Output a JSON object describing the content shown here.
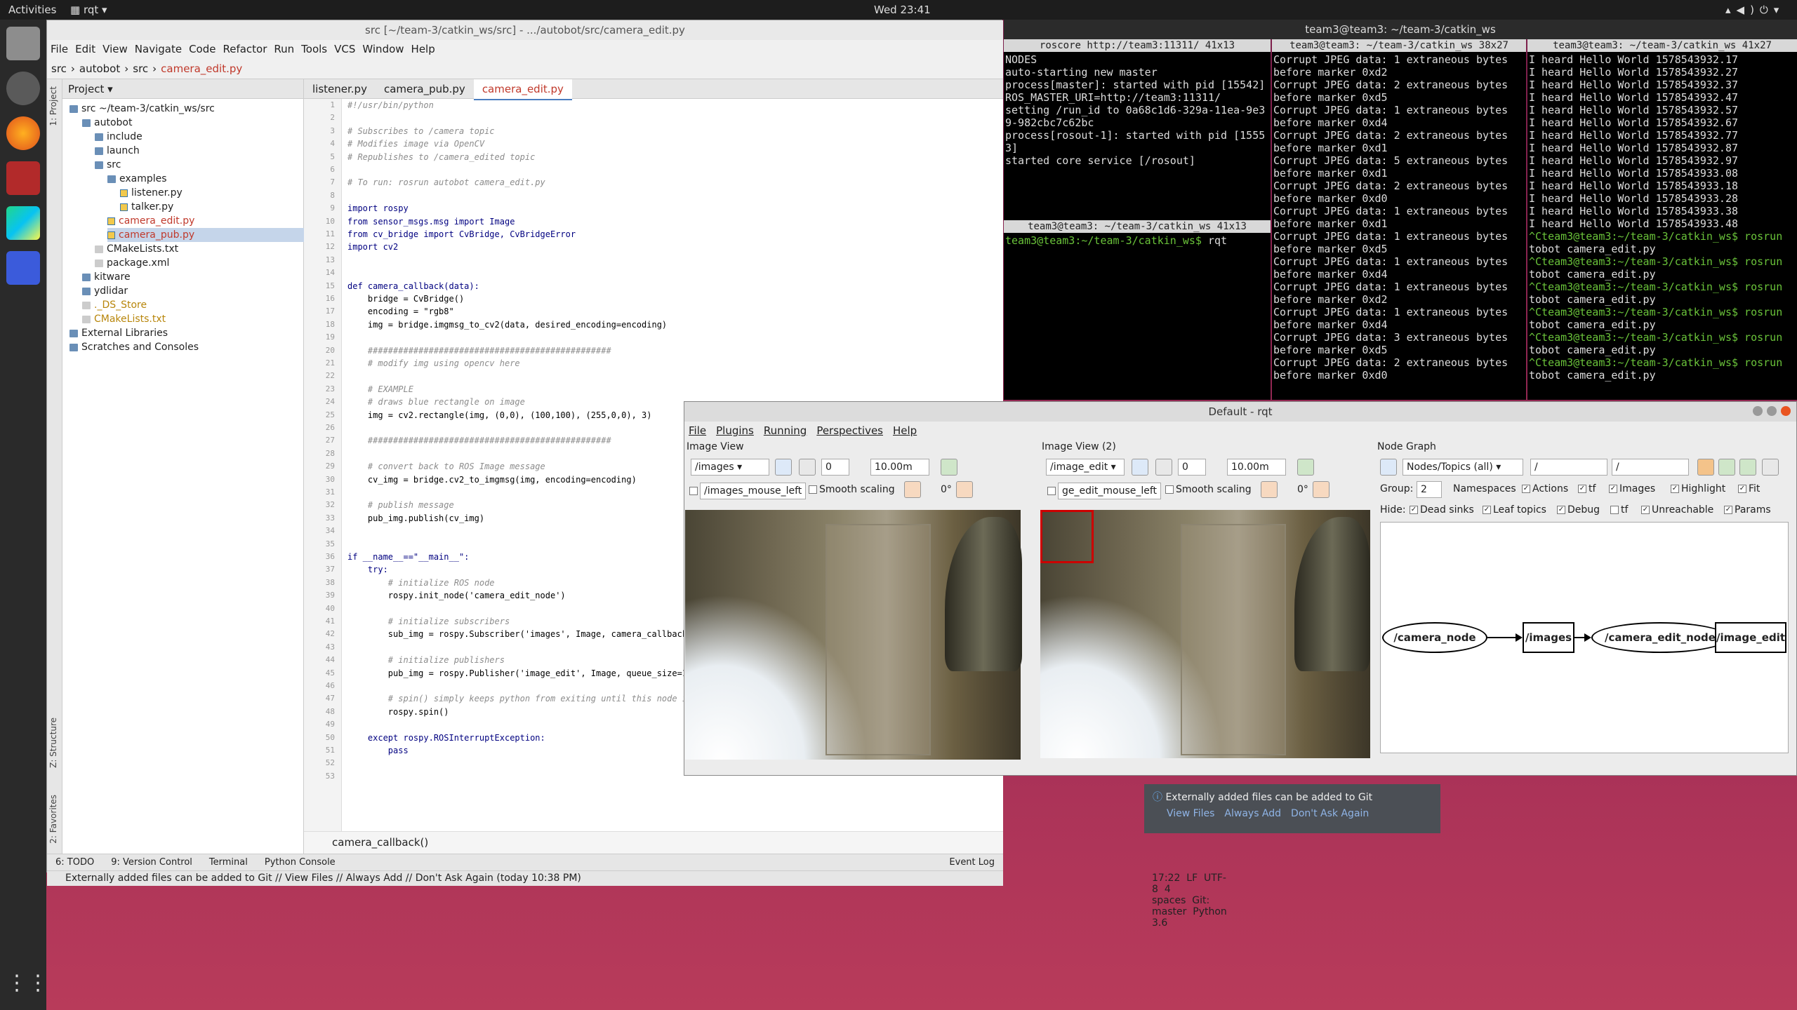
{
  "topbar": {
    "activities": "Activities",
    "app": "rqt",
    "clock": "Wed 23:41"
  },
  "ide": {
    "title": "src [~/team-3/catkin_ws/src] - .../autobot/src/camera_edit.py",
    "menu": [
      "File",
      "Edit",
      "View",
      "Navigate",
      "Code",
      "Refactor",
      "Run",
      "Tools",
      "VCS",
      "Window",
      "Help"
    ],
    "breadcrumb": [
      "src",
      "autobot",
      "src",
      "camera_edit.py"
    ],
    "side_tabs": {
      "project": "1: Project",
      "structure": "Z: Structure",
      "favorites": "2: Favorites"
    },
    "project_header": "Project",
    "tree": [
      {
        "label": "src  ~/team-3/catkin_ws/src",
        "kind": "folder"
      },
      {
        "label": "autobot",
        "kind": "folder"
      },
      {
        "label": "include",
        "kind": "folder"
      },
      {
        "label": "launch",
        "kind": "folder"
      },
      {
        "label": "src",
        "kind": "folder"
      },
      {
        "label": "examples",
        "kind": "folder"
      },
      {
        "label": "listener.py",
        "kind": "py"
      },
      {
        "label": "talker.py",
        "kind": "py"
      },
      {
        "label": "camera_edit.py",
        "kind": "py"
      },
      {
        "label": "camera_pub.py",
        "kind": "py"
      },
      {
        "label": "CMakeLists.txt",
        "kind": "file"
      },
      {
        "label": "package.xml",
        "kind": "file"
      },
      {
        "label": "kitware",
        "kind": "folder"
      },
      {
        "label": "ydlidar",
        "kind": "folder"
      },
      {
        "label": "._DS_Store",
        "kind": "file"
      },
      {
        "label": "CMakeLists.txt",
        "kind": "file"
      },
      {
        "label": "External Libraries",
        "kind": "folder"
      },
      {
        "label": "Scratches and Consoles",
        "kind": "folder"
      }
    ],
    "tabs": [
      "listener.py",
      "camera_pub.py",
      "camera_edit.py"
    ],
    "code": [
      {
        "n": "1",
        "t": "#!/usr/bin/python",
        "c": "cm"
      },
      {
        "n": "2",
        "t": "",
        "c": ""
      },
      {
        "n": "3",
        "t": "# Subscribes to /camera topic",
        "c": "cm"
      },
      {
        "n": "4",
        "t": "# Modifies image via OpenCV",
        "c": "cm"
      },
      {
        "n": "5",
        "t": "# Republishes to /camera_edited topic",
        "c": "cm"
      },
      {
        "n": "6",
        "t": "",
        "c": ""
      },
      {
        "n": "7",
        "t": "# To run: rosrun autobot camera_edit.py",
        "c": "cm"
      },
      {
        "n": "8",
        "t": "",
        "c": ""
      },
      {
        "n": "9",
        "t": "import rospy",
        "c": "kw"
      },
      {
        "n": "10",
        "t": "from sensor_msgs.msg import Image",
        "c": "kw"
      },
      {
        "n": "11",
        "t": "from cv_bridge import CvBridge, CvBridgeError",
        "c": "kw"
      },
      {
        "n": "12",
        "t": "import cv2",
        "c": "kw"
      },
      {
        "n": "13",
        "t": "",
        "c": ""
      },
      {
        "n": "14",
        "t": "",
        "c": ""
      },
      {
        "n": "15",
        "t": "def camera_callback(data):",
        "c": "kw"
      },
      {
        "n": "16",
        "t": "    bridge = CvBridge()",
        "c": ""
      },
      {
        "n": "17",
        "t": "    encoding = \"rgb8\"",
        "c": ""
      },
      {
        "n": "18",
        "t": "    img = bridge.imgmsg_to_cv2(data, desired_encoding=encoding)",
        "c": ""
      },
      {
        "n": "19",
        "t": "",
        "c": ""
      },
      {
        "n": "20",
        "t": "    ################################################",
        "c": "cm"
      },
      {
        "n": "21",
        "t": "    # modify img using opencv here",
        "c": "cm"
      },
      {
        "n": "22",
        "t": "",
        "c": ""
      },
      {
        "n": "23",
        "t": "    # EXAMPLE",
        "c": "cm"
      },
      {
        "n": "24",
        "t": "    # draws blue rectangle on image",
        "c": "cm"
      },
      {
        "n": "25",
        "t": "    img = cv2.rectangle(img, (0,0), (100,100), (255,0,0), 3)",
        "c": ""
      },
      {
        "n": "26",
        "t": "",
        "c": ""
      },
      {
        "n": "27",
        "t": "    ################################################",
        "c": "cm"
      },
      {
        "n": "28",
        "t": "",
        "c": ""
      },
      {
        "n": "29",
        "t": "    # convert back to ROS Image message",
        "c": "cm"
      },
      {
        "n": "30",
        "t": "    cv_img = bridge.cv2_to_imgmsg(img, encoding=encoding)",
        "c": ""
      },
      {
        "n": "31",
        "t": "",
        "c": ""
      },
      {
        "n": "32",
        "t": "    # publish message",
        "c": "cm"
      },
      {
        "n": "33",
        "t": "    pub_img.publish(cv_img)",
        "c": ""
      },
      {
        "n": "34",
        "t": "",
        "c": ""
      },
      {
        "n": "35",
        "t": "",
        "c": ""
      },
      {
        "n": "36",
        "t": "if __name__==\"__main__\":",
        "c": "kw"
      },
      {
        "n": "37",
        "t": "    try:",
        "c": "kw"
      },
      {
        "n": "38",
        "t": "        # initialize ROS node",
        "c": "cm"
      },
      {
        "n": "39",
        "t": "        rospy.init_node('camera_edit_node')",
        "c": ""
      },
      {
        "n": "40",
        "t": "",
        "c": ""
      },
      {
        "n": "41",
        "t": "        # initialize subscribers",
        "c": "cm"
      },
      {
        "n": "42",
        "t": "        sub_img = rospy.Subscriber('images', Image, camera_callback,",
        "c": ""
      },
      {
        "n": "43",
        "t": "",
        "c": ""
      },
      {
        "n": "44",
        "t": "        # initialize publishers",
        "c": "cm"
      },
      {
        "n": "45",
        "t": "        pub_img = rospy.Publisher('image_edit', Image, queue_size=10)",
        "c": ""
      },
      {
        "n": "46",
        "t": "",
        "c": ""
      },
      {
        "n": "47",
        "t": "        # spin() simply keeps python from exiting until this node is",
        "c": "cm"
      },
      {
        "n": "48",
        "t": "        rospy.spin()",
        "c": ""
      },
      {
        "n": "49",
        "t": "",
        "c": ""
      },
      {
        "n": "50",
        "t": "    except rospy.ROSInterruptException:",
        "c": "kw"
      },
      {
        "n": "51",
        "t": "        pass",
        "c": "kw"
      },
      {
        "n": "52",
        "t": "",
        "c": ""
      },
      {
        "n": "53",
        "t": "",
        "c": ""
      }
    ],
    "function_crumb": "camera_callback()",
    "toolwindows": [
      "6: TODO",
      "9: Version Control",
      "Terminal",
      "Python Console",
      "Event Log"
    ],
    "status_msg": "Externally added files can be added to Git // View Files // Always Add // Don't Ask Again (today 10:38 PM)",
    "status_right": [
      "17:22",
      "LF",
      "UTF-8",
      "4 spaces",
      "Git: master",
      "Python 3.6"
    ]
  },
  "notification": {
    "text": "Externally added files can be added to Git",
    "links": [
      "View Files",
      "Always Add",
      "Don't Ask Again"
    ]
  },
  "terminals": {
    "window_title": "team3@team3: ~/team-3/catkin_ws",
    "roscore": {
      "title": "roscore http://team3:11311/ 41x13",
      "lines": [
        "",
        "NODES",
        "",
        "auto-starting new master",
        "process[master]: started with pid [15542]",
        "ROS_MASTER_URI=http://team3:11311/",
        "",
        "setting /run_id to 0a68c1d6-329a-11ea-9e3",
        "9-982cbc7c62bc",
        "process[rosout-1]: started with pid [1555",
        "3]",
        "started core service [/rosout]"
      ]
    },
    "rqt_term": {
      "title": "team3@team3: ~/team-3/catkin_ws 41x13",
      "prompt": "team3@team3:~/team-3/catkin_ws$",
      "cmd": " rqt"
    },
    "jpeg": {
      "title": "team3@team3: ~/team-3/catkin_ws 38x27",
      "lines": [
        "Corrupt JPEG data: 1 extraneous bytes",
        "before marker 0xd2",
        "Corrupt JPEG data: 2 extraneous bytes",
        "before marker 0xd5",
        "Corrupt JPEG data: 1 extraneous bytes",
        "before marker 0xd4",
        "Corrupt JPEG data: 2 extraneous bytes",
        "before marker 0xd1",
        "Corrupt JPEG data: 5 extraneous bytes",
        "before marker 0xd1",
        "Corrupt JPEG data: 2 extraneous bytes",
        "before marker 0xd0",
        "Corrupt JPEG data: 1 extraneous bytes",
        "before marker 0xd1",
        "Corrupt JPEG data: 1 extraneous bytes",
        "before marker 0xd5",
        "Corrupt JPEG data: 1 extraneous bytes",
        "before marker 0xd4",
        "Corrupt JPEG data: 1 extraneous bytes",
        "before marker 0xd2",
        "Corrupt JPEG data: 1 extraneous bytes",
        "before marker 0xd4",
        "Corrupt JPEG data: 3 extraneous bytes",
        "before marker 0xd5",
        "Corrupt JPEG data: 2 extraneous bytes",
        "before marker 0xd0"
      ]
    },
    "hello": {
      "title": "team3@team3: ~/team-3/catkin_ws 41x27",
      "lines": [
        "I heard Hello World 1578543932.17",
        "I heard Hello World 1578543932.27",
        "I heard Hello World 1578543932.37",
        "I heard Hello World 1578543932.47",
        "I heard Hello World 1578543932.57",
        "I heard Hello World 1578543932.67",
        "I heard Hello World 1578543932.77",
        "I heard Hello World 1578543932.87",
        "I heard Hello World 1578543932.97",
        "I heard Hello World 1578543933.08",
        "I heard Hello World 1578543933.18",
        "I heard Hello World 1578543933.28",
        "I heard Hello World 1578543933.38",
        "I heard Hello World 1578543933.48"
      ],
      "runs": [
        "^Cteam3@team3:~/team-3/catkin_ws$ rosrun",
        "tobot camera_edit.py"
      ]
    }
  },
  "rqt": {
    "title": "Default - rqt",
    "menu": [
      "File",
      "Plugins",
      "Running",
      "Perspectives",
      "Help"
    ],
    "view1": {
      "title": "Image View",
      "topic": "/images",
      "num": "0",
      "scale": "10.00m",
      "mouse": "/images_mouse_left",
      "smooth": "Smooth scaling",
      "rot": "0°"
    },
    "view2": {
      "title": "Image View (2)",
      "topic": "/image_edit",
      "num": "0",
      "scale": "10.00m",
      "mouse": "ge_edit_mouse_left",
      "smooth": "Smooth scaling",
      "rot": "0°"
    },
    "graph": {
      "title": "Node Graph",
      "mode": "Nodes/Topics (all)",
      "filter1": "/",
      "filter2": "/",
      "group_label": "Group:",
      "group_val": "2",
      "checks": [
        "Namespaces",
        "Actions",
        "tf",
        "Images",
        "Highlight",
        "Fit"
      ],
      "hide_label": "Hide:",
      "hide": [
        "Dead sinks",
        "Leaf topics",
        "Debug",
        "tf",
        "Unreachable",
        "Params"
      ],
      "nodes": [
        "/camera_node",
        "/images",
        "/camera_edit_node",
        "/image_edit"
      ]
    },
    "accent": "#cc0000"
  }
}
